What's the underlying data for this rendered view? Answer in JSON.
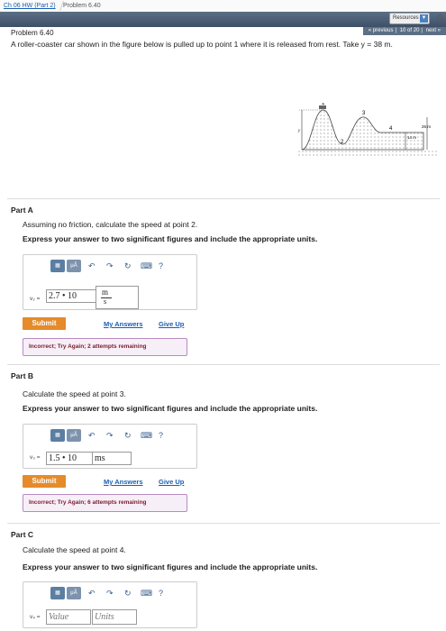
{
  "breadcrumb": {
    "parent": "Ch 06 HW (Part 2)",
    "current": "Problem 6.40"
  },
  "header": {
    "resources_label": "Resources",
    "pager": {
      "previous": "« previous",
      "position": "10 of 20",
      "next": "next »"
    }
  },
  "problem": {
    "title": "Problem 6.40",
    "statement": "A roller-coaster car shown in the figure below is pulled up to point 1 where it is released from rest. Take y = 38 m.",
    "figure": {
      "labels": [
        "1",
        "2",
        "3",
        "4",
        "y",
        "26 m",
        "14 m"
      ]
    }
  },
  "toolbar_icons": [
    "matrix-icon",
    "mu-icon",
    "undo-icon",
    "redo-icon",
    "reset-icon",
    "keyboard-icon",
    "help-icon"
  ],
  "parts": [
    {
      "heading": "Part A",
      "question": "Assuming no friction, calculate the speed at point 2.",
      "instruction": "Express your answer to two significant figures and include the appropriate units.",
      "variable": "v₂ =",
      "value": "2.7 • 10",
      "unit_numerator": "m",
      "unit_denominator": "s",
      "submit": "Submit",
      "my_answers": "My Answers",
      "give_up": "Give Up",
      "feedback": "Incorrect; Try Again; 2 attempts remaining"
    },
    {
      "heading": "Part B",
      "question": "Calculate the speed at point 3.",
      "instruction": "Express your answer to two significant figures and include the appropriate units.",
      "variable": "v₃ =",
      "value": "1.5 • 10",
      "unit": "ms",
      "submit": "Submit",
      "my_answers": "My Answers",
      "give_up": "Give Up",
      "feedback": "Incorrect; Try Again; 6 attempts remaining"
    },
    {
      "heading": "Part C",
      "question": "Calculate the speed at point 4.",
      "instruction": "Express your answer to two significant figures and include the appropriate units.",
      "variable": "v₄ =",
      "value_placeholder": "Value",
      "unit_placeholder": "Units"
    }
  ]
}
